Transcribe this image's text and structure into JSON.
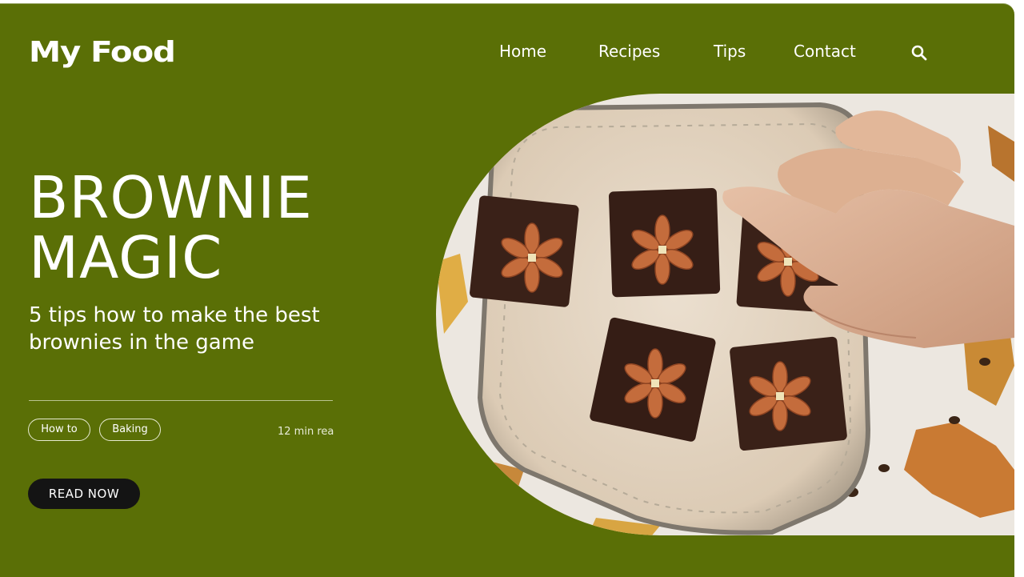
{
  "brand": {
    "logo": "My Food"
  },
  "nav": {
    "items": [
      "Home",
      "Recipes",
      "Tips",
      "Contact"
    ],
    "search_icon": "search-icon"
  },
  "hero": {
    "title_line1": "BROWNIE",
    "title_line2": "MAGIC",
    "subtitle": "5 tips how to make the best brownies in the game",
    "tags": [
      "How to",
      "Baking"
    ],
    "read_time": "12 min rea",
    "cta": "READ NOW",
    "image": "brownies-with-almonds-on-plate"
  },
  "colors": {
    "background": "#5a6f06",
    "text": "#ffffff",
    "button": "#141414"
  }
}
